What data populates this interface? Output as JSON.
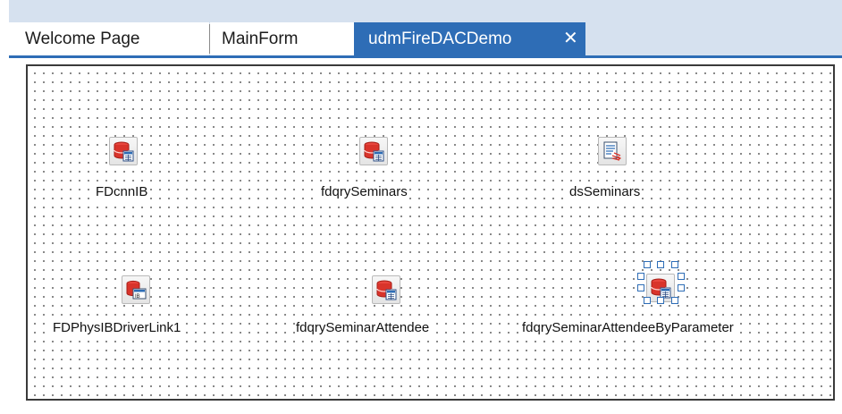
{
  "tabs": [
    {
      "label": "Welcome Page",
      "active": false
    },
    {
      "label": "MainForm",
      "active": false
    },
    {
      "label": "udmFireDACDemo",
      "active": true,
      "close_glyph": "✕"
    }
  ],
  "components": [
    {
      "name": "FDcnnIB",
      "icon": "fdconnection-icon"
    },
    {
      "name": "fdqrySeminars",
      "icon": "fdquery-icon"
    },
    {
      "name": "dsSeminars",
      "icon": "datasource-icon"
    },
    {
      "name": "FDPhysIBDriverLink1",
      "icon": "ib-driver-link-icon"
    },
    {
      "name": "fdqrySeminarAttendee",
      "icon": "fdquery-icon"
    },
    {
      "name": "fdqrySeminarAttendeeByParameter",
      "icon": "fdquery-icon",
      "selected": true
    }
  ],
  "colors": {
    "accent": "#2e6db6",
    "tabbar_background": "#d6e1ef",
    "grid_dot": "#6b6b6b",
    "db_icon_red": "#d9342b"
  }
}
